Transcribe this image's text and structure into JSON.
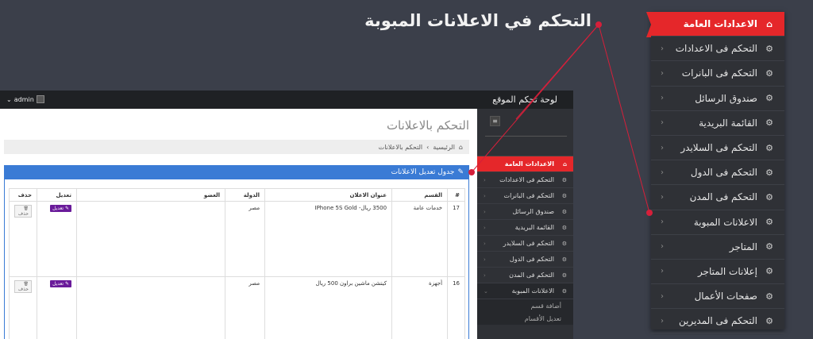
{
  "headline": "التحكم في الاعلانات المبوبة",
  "big_menu": [
    {
      "label": "الاعدادات العامة",
      "icon": "home-icon",
      "active": true
    },
    {
      "label": "التحكم فى الاعدادات",
      "icon": "gears-icon"
    },
    {
      "label": "التحكم فى البانرات",
      "icon": "gears-icon"
    },
    {
      "label": "صندوق الرسائل",
      "icon": "gears-icon"
    },
    {
      "label": "القائمة البريدية",
      "icon": "gears-icon"
    },
    {
      "label": "التحكم فى السلايدر",
      "icon": "gears-icon"
    },
    {
      "label": "التحكم فى الدول",
      "icon": "gears-icon"
    },
    {
      "label": "التحكم فى المدن",
      "icon": "gears-icon"
    },
    {
      "label": "الاعلانات المبوبة",
      "icon": "gears-icon"
    },
    {
      "label": "المتاجر",
      "icon": "gears-icon"
    },
    {
      "label": "إعلانات المتاجر",
      "icon": "gears-icon"
    },
    {
      "label": "صفحات الأعمال",
      "icon": "gears-icon"
    },
    {
      "label": "التحكم فى المديرين",
      "icon": "gears-icon"
    }
  ],
  "topbar": {
    "site_title": "لوحة تحكم الموقع",
    "user": "admin"
  },
  "page_title": "التحكم بالاعلانات",
  "breadcrumb": {
    "home": "الرئيسية",
    "sep": "›",
    "current": "التحكم بالاعلانات"
  },
  "panel_title": "جدول تعديل الاعلانات",
  "table": {
    "headers": [
      "#",
      "القسم",
      "عنوان الاعلان",
      "الدولة",
      "العضو",
      "تعديل",
      "حذف"
    ],
    "rows": [
      {
        "id": "17",
        "section": "خدمات عامة",
        "title": "3500 ريال- IPhone 5S Gold",
        "country": "مصر",
        "member": ""
      },
      {
        "id": "16",
        "section": "أجهزة",
        "title": "كيتشن ماشين براون 500 ريال",
        "country": "مصر",
        "member": ""
      }
    ],
    "edit_label": "تعديل",
    "delete_label": "حذف"
  },
  "side_menu": [
    {
      "label": "الاعدادات العامة",
      "active": true
    },
    {
      "label": "التحكم فى الاعدادات"
    },
    {
      "label": "التحكم فى البانرات"
    },
    {
      "label": "صندوق الرسائل"
    },
    {
      "label": "القائمة البريدية"
    },
    {
      "label": "التحكم فى السلايدر"
    },
    {
      "label": "التحكم فى الدول"
    },
    {
      "label": "التحكم فى المدن"
    },
    {
      "label": "الاعلانات المبوبة",
      "open": true
    }
  ],
  "side_sub": [
    "أضافة قسم",
    "تعديل الأقسام"
  ],
  "colors": {
    "accent_red": "#e5272a",
    "panel_blue": "#3a7bd5",
    "menu_bg": "#2f3136",
    "edit_purple": "#6a1b9a"
  }
}
